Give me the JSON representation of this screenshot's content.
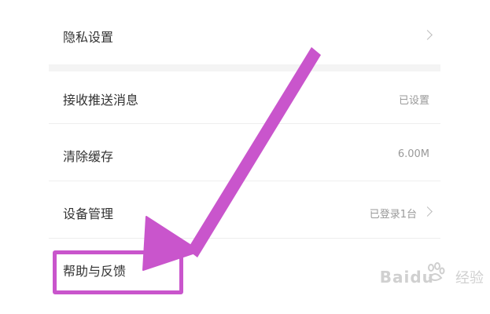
{
  "settings": {
    "items": [
      {
        "label": "隐私设置",
        "value": ""
      },
      {
        "label": "接收推送消息",
        "value": "已设置"
      },
      {
        "label": "清除缓存",
        "value": "6.00M"
      },
      {
        "label": "设备管理",
        "value": "已登录1台"
      },
      {
        "label": "帮助与反馈",
        "value": ""
      }
    ]
  },
  "watermark": {
    "brand": "Baidu",
    "suffix": "经验"
  },
  "colors": {
    "annotation": "#c955cc",
    "text": "#333333",
    "secondary": "#999999"
  }
}
